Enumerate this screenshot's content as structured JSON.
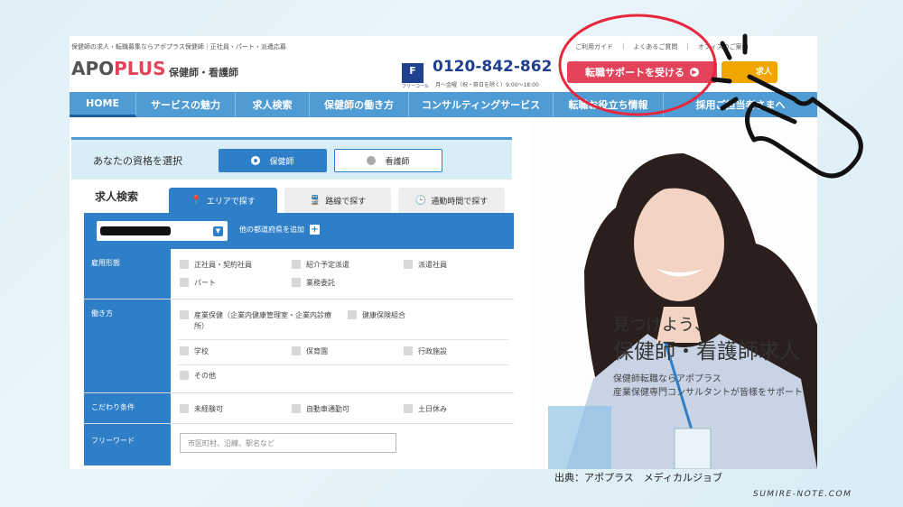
{
  "header": {
    "tagline": "保健師の求人・転職募集ならアポプラス保健師｜正社員・パート・派遣応募",
    "logo_main": "APO",
    "logo_plus": "PLUS",
    "logo_sub": "保健師・看護師",
    "freedial_badge": "F",
    "freedial_sub": "フリーコール",
    "phone": "0120-842-862",
    "hours": "月〜金曜（祝・祭日を除く）9:00〜18:00",
    "links": [
      "ご利用ガイド",
      "よくあるご質問",
      "オフィスのご案内"
    ],
    "support_button": "転職サポートを受ける",
    "jobs_button": "求人"
  },
  "nav": {
    "items": [
      "HOME",
      "サービスの魅力",
      "求人検索",
      "保健師の働き方",
      "コンサルティングサービス",
      "転職お役立ち情報",
      "採用ご担当者さまへ"
    ]
  },
  "qualification": {
    "label": "あなたの資格を選択",
    "options": [
      "保健師",
      "看護師"
    ]
  },
  "search": {
    "title": "求人検索",
    "tabs": [
      "エリアで探す",
      "路線で探す",
      "通勤時間で探す"
    ],
    "add_prefecture": "他の都道府県を追加"
  },
  "filters": {
    "employment": {
      "label": "雇用形態",
      "options": [
        "正社員・契約社員",
        "紹介予定派遣",
        "派遣社員",
        "パート",
        "業務委託"
      ]
    },
    "workstyle": {
      "label": "働き方",
      "options": [
        "産業保健（企業内健康管理室・企業内診療所）",
        "健康保険組合",
        "学校",
        "保育園",
        "行政施設",
        "その他"
      ]
    },
    "preferences": {
      "label": "こだわり条件",
      "options": [
        "未経験可",
        "自動車通勤可",
        "土日休み"
      ]
    },
    "freeword": {
      "label": "フリーワード",
      "placeholder": "市区町村、沿線、駅名など"
    }
  },
  "hero": {
    "headline1": "見つけよう、",
    "headline2": "保健師・看護師求人",
    "sub1": "保健師転職ならアポプラス",
    "sub2": "産業保健専門コンサルタントが皆様をサポート"
  },
  "caption": {
    "source": "出典：アポプラス　メディカルジョブ",
    "watermark": "SUMIRE-NOTE.COM"
  },
  "colors": {
    "nav_blue": "#4f9bd3",
    "accent_blue": "#2f7fc8",
    "brand_red": "#e4435c",
    "jobs_orange": "#f0a500",
    "annotation_red": "#e8263c"
  }
}
